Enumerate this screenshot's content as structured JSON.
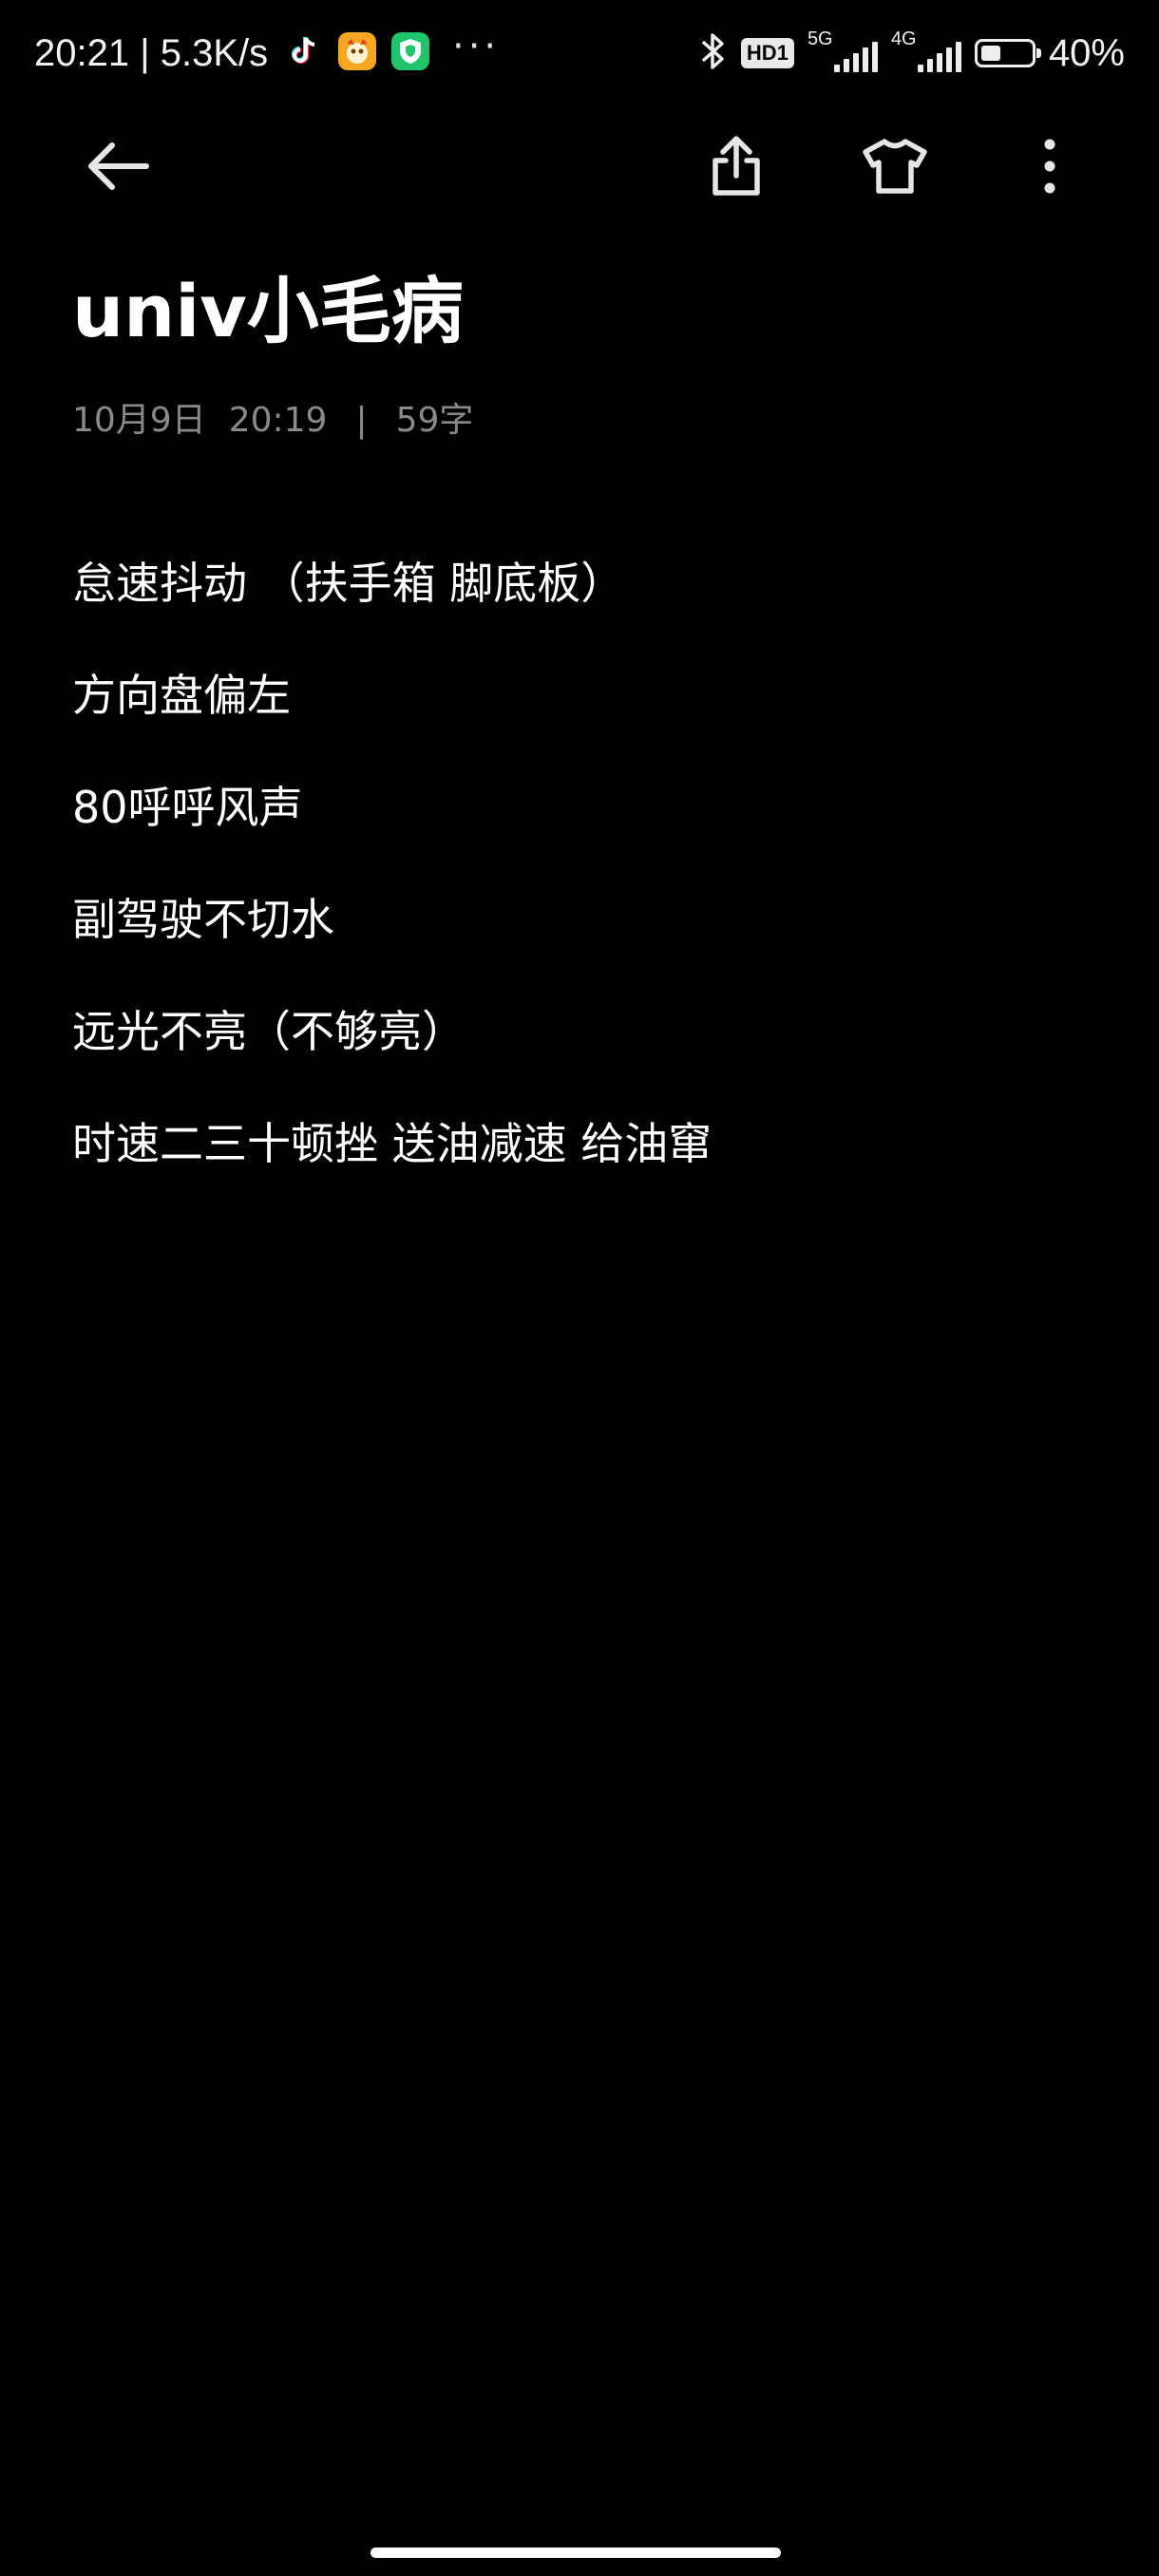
{
  "status_bar": {
    "time_and_speed": "20:21 | 5.3K/s",
    "hd_badge": "HD1",
    "net_5g": "5G",
    "net_4g": "4G",
    "battery_level": 0.4,
    "battery_text": "40%"
  },
  "note": {
    "title": "univ小毛病",
    "date": "10月9日",
    "time": "20:19",
    "separator": "|",
    "char_count": "59字",
    "lines": [
      "怠速抖动 （扶手箱  脚底板）",
      "方向盘偏左",
      "80呼呼风声",
      "副驾驶不切水",
      "远光不亮（不够亮）",
      "时速二三十顿挫 送油减速 给油窜"
    ]
  },
  "colors": {
    "background": "#000000",
    "text": "#ffffff",
    "meta": "#8a8a8a"
  }
}
